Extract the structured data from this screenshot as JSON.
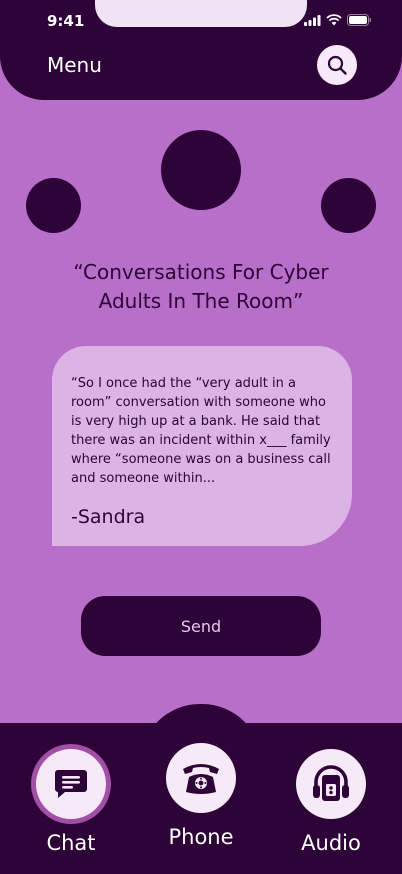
{
  "status_bar": {
    "time": "9:41"
  },
  "header": {
    "title": "Menu"
  },
  "quote": {
    "title": "“Conversations For Cyber Adults In The Room”"
  },
  "card": {
    "text": "“So I once had the “very adult in a room” conversation with someone who is very high up at a bank. He said that there was an incident within x___ family where “someone was on a business call and someone within...",
    "author": "-Sandra"
  },
  "send": {
    "label": "Send"
  },
  "tabs": [
    {
      "label": "Chat",
      "icon": "chat-icon",
      "active": true
    },
    {
      "label": "Phone",
      "icon": "telephone-icon",
      "active": false
    },
    {
      "label": "Audio",
      "icon": "audio-player-icon",
      "active": false
    }
  ],
  "colors": {
    "dark": "#2e0337",
    "background": "#b86fc9",
    "card": "#dcb3e5",
    "light": "#f6e9f8",
    "ring": "#a24fa8"
  }
}
